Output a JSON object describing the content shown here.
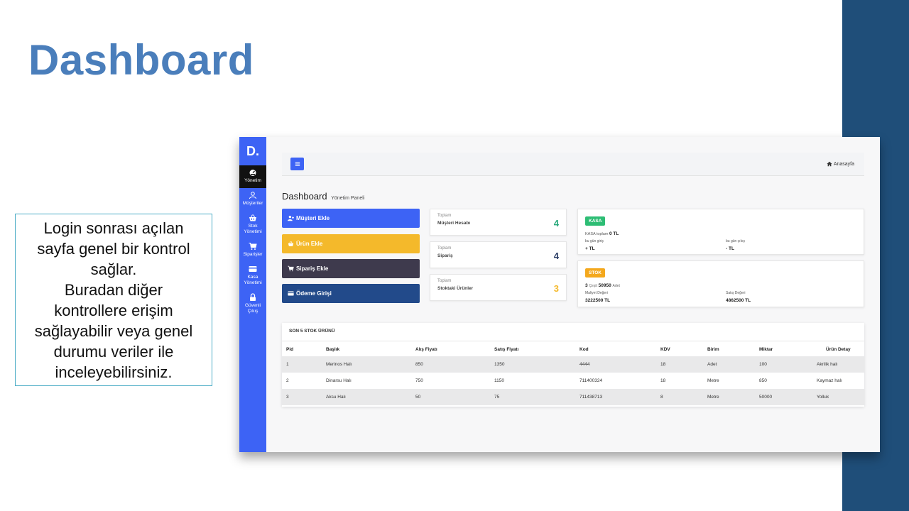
{
  "slide": {
    "title": "Dashboard",
    "description": "Login sonrası açılan\nsayfa genel bir kontrol\nsağlar.\nBuradan diğer\nkontrollere erişim\nsağlayabilir veya genel\ndurumu veriler ile\ninceleyebilirsiniz.",
    "band_color": "#1f4e79",
    "title_color": "#4a7ebb"
  },
  "app": {
    "logo": "D.",
    "sidebar": [
      {
        "label": "Yönetim",
        "icon": "gauge-icon",
        "active": true
      },
      {
        "label": "Müşteriler",
        "icon": "user-icon",
        "active": false
      },
      {
        "label": "Stok Yönetimi",
        "icon": "basket-icon",
        "active": false
      },
      {
        "label": "Siparişler",
        "icon": "cart-icon",
        "active": false
      },
      {
        "label": "Kasa Yönetimi",
        "icon": "credit-card-icon",
        "active": false
      },
      {
        "label": "Güvenli Çıkış",
        "icon": "lock-icon",
        "active": false
      }
    ],
    "breadcrumb": "Anasayfa",
    "heading": "Dashboard",
    "subheading": "Yönetim Paneli",
    "quick_actions": [
      {
        "label": "Müşteri Ekle",
        "icon": "user-plus-icon",
        "color": "#3d63f5"
      },
      {
        "label": "Ürün Ekle",
        "icon": "basket-icon",
        "color": "#f4b92b"
      },
      {
        "label": "Sipariş Ekle",
        "icon": "cart-icon",
        "color": "#3e3a4d"
      },
      {
        "label": "Ödeme Girişi",
        "icon": "credit-card-icon",
        "color": "#224a8a"
      }
    ],
    "stats": [
      {
        "small": "Toplam",
        "label": "Müşteri Hesabı",
        "value": "4",
        "color": "#28a87a"
      },
      {
        "small": "Toplam",
        "label": "Sipariş",
        "value": "4",
        "color": "#2c3e66"
      },
      {
        "small": "Toplam",
        "label": "Stoktaki Ürünler",
        "value": "3",
        "color": "#f4b92b"
      }
    ],
    "kasa": {
      "badge": "KASA",
      "total_label": "KASA toplam",
      "total_value": "0 TL",
      "in_label": "bu gün giriş",
      "in_value": "+ TL",
      "out_label": "bu gün çıkış",
      "out_value": "- TL",
      "badge_color": "#2dbd74"
    },
    "stok": {
      "badge": "STOK",
      "summary_count": "3",
      "summary_cesit": "Çeşit",
      "summary_qty": "50950",
      "summary_unit": "Adet",
      "cost_label": "Maliyet Değeri",
      "cost_value": "3222500 TL",
      "sale_label": "Satış Değeri",
      "sale_value": "4862500 TL",
      "badge_color": "#f4a81d"
    },
    "table": {
      "title": "SON 5 STOK ÜRÜNÜ",
      "headers": [
        "Pid",
        "Başlık",
        "Alış Fiyatı",
        "Satış Fiyatı",
        "Kod",
        "KDV",
        "Birim",
        "Miktar",
        "Ürün Detay"
      ],
      "rows": [
        [
          "1",
          "Merinos Halı",
          "850",
          "1350",
          "4444",
          "18",
          "Adet",
          "100",
          "Akrilik halı"
        ],
        [
          "2",
          "Dinarsu Halı",
          "750",
          "1150",
          "711400324",
          "18",
          "Metre",
          "850",
          "Kaymaz halı"
        ],
        [
          "3",
          "Aksu Halı",
          "50",
          "75",
          "711438713",
          "8",
          "Metre",
          "50000",
          "Yolluk"
        ]
      ]
    }
  }
}
